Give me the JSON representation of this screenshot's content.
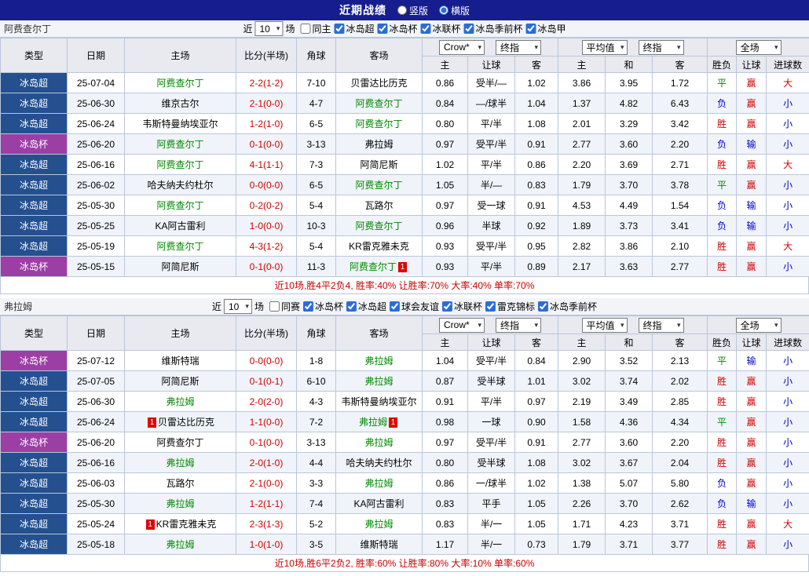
{
  "colors": {
    "topbar": "#161D8E",
    "lgsuper": "#24508F",
    "lgcup": "#9B3FA5",
    "win": "#D10000",
    "loss": "#0000CC",
    "draw": "#008800",
    "focus": "#008800",
    "score": "#D10000",
    "summary": "#C80000",
    "rowalt": "#F0F4FA",
    "border": "#B9C6DA",
    "headbg": "#E9E9F0",
    "sectionbg": "#F2F4F8"
  },
  "header": {
    "title": "近期战绩",
    "radio_vertical": "竖版",
    "radio_horizontal": "横版",
    "vertical_selected": false,
    "horizontal_selected": true
  },
  "labels": {
    "near": "近",
    "games": "场"
  },
  "table_headers": {
    "type": "类型",
    "date": "日期",
    "home": "主场",
    "score": "比分(半场)",
    "corner": "角球",
    "away": "客场",
    "odds_select": "Crow*",
    "final_select": "终指",
    "avg_select": "平均值",
    "avg_final_select": "终指",
    "scope_select": "全场",
    "odds_home": "主",
    "odds_handicap": "让球",
    "odds_away": "客",
    "avg_home": "主",
    "avg_draw": "和",
    "avg_away": "客",
    "result": "胜负",
    "handicap_result": "让球",
    "goals": "进球数"
  },
  "sections": [
    {
      "team": "阿费查尔丁",
      "filter": {
        "games_value": "10",
        "checkboxes": [
          {
            "label": "同主",
            "checked": false
          },
          {
            "label": "冰岛超",
            "checked": true
          },
          {
            "label": "冰岛杯",
            "checked": true
          },
          {
            "label": "冰联杯",
            "checked": true
          },
          {
            "label": "冰岛季前杯",
            "checked": true
          },
          {
            "label": "冰岛甲",
            "checked": true
          }
        ]
      },
      "table": {
        "rows": [
          {
            "league": "冰岛超",
            "lg_class": "super",
            "date": "25-07-04",
            "home": "阿费查尔丁",
            "home_focus": true,
            "home_red": "",
            "score": "2-2(1-2)",
            "corner": "7-10",
            "away": "贝雷达比历克",
            "away_focus": false,
            "away_red": "",
            "odds_home": "0.86",
            "handicap": "受半/—",
            "odds_away": "1.02",
            "avg_home": "3.86",
            "avg_draw": "3.95",
            "avg_away": "1.72",
            "result": "平",
            "hcap_result": "赢",
            "goals": "大"
          },
          {
            "league": "冰岛超",
            "lg_class": "super",
            "date": "25-06-30",
            "home": "维京古尔",
            "home_focus": false,
            "home_red": "",
            "score": "2-1(0-0)",
            "corner": "4-7",
            "away": "阿费查尔丁",
            "away_focus": true,
            "away_red": "",
            "odds_home": "0.84",
            "handicap": "—/球半",
            "odds_away": "1.04",
            "avg_home": "1.37",
            "avg_draw": "4.82",
            "avg_away": "6.43",
            "result": "负",
            "hcap_result": "赢",
            "goals": "小"
          },
          {
            "league": "冰岛超",
            "lg_class": "super",
            "date": "25-06-24",
            "home": "韦斯特曼纳埃亚尔",
            "home_focus": false,
            "home_red": "",
            "score": "1-2(1-0)",
            "corner": "6-5",
            "away": "阿费查尔丁",
            "away_focus": true,
            "away_red": "",
            "odds_home": "0.80",
            "handicap": "平/半",
            "odds_away": "1.08",
            "avg_home": "2.01",
            "avg_draw": "3.29",
            "avg_away": "3.42",
            "result": "胜",
            "hcap_result": "赢",
            "goals": "小"
          },
          {
            "league": "冰岛杯",
            "lg_class": "cup",
            "date": "25-06-20",
            "home": "阿费查尔丁",
            "home_focus": true,
            "home_red": "",
            "score": "0-1(0-0)",
            "corner": "3-13",
            "away": "弗拉姆",
            "away_focus": false,
            "away_red": "",
            "odds_home": "0.97",
            "handicap": "受平/半",
            "odds_away": "0.91",
            "avg_home": "2.77",
            "avg_draw": "3.60",
            "avg_away": "2.20",
            "result": "负",
            "hcap_result": "输",
            "goals": "小"
          },
          {
            "league": "冰岛超",
            "lg_class": "super",
            "date": "25-06-16",
            "home": "阿费查尔丁",
            "home_focus": true,
            "home_red": "",
            "score": "4-1(1-1)",
            "corner": "7-3",
            "away": "阿简尼斯",
            "away_focus": false,
            "away_red": "",
            "odds_home": "1.02",
            "handicap": "平/半",
            "odds_away": "0.86",
            "avg_home": "2.20",
            "avg_draw": "3.69",
            "avg_away": "2.71",
            "result": "胜",
            "hcap_result": "赢",
            "goals": "大"
          },
          {
            "league": "冰岛超",
            "lg_class": "super",
            "date": "25-06-02",
            "home": "哈夫纳夫约杜尔",
            "home_focus": false,
            "home_red": "",
            "score": "0-0(0-0)",
            "corner": "6-5",
            "away": "阿费查尔丁",
            "away_focus": true,
            "away_red": "",
            "odds_home": "1.05",
            "handicap": "半/—",
            "odds_away": "0.83",
            "avg_home": "1.79",
            "avg_draw": "3.70",
            "avg_away": "3.78",
            "result": "平",
            "hcap_result": "赢",
            "goals": "小"
          },
          {
            "league": "冰岛超",
            "lg_class": "super",
            "date": "25-05-30",
            "home": "阿费查尔丁",
            "home_focus": true,
            "home_red": "",
            "score": "0-2(0-2)",
            "corner": "5-4",
            "away": "瓦路尔",
            "away_focus": false,
            "away_red": "",
            "odds_home": "0.97",
            "handicap": "受一球",
            "odds_away": "0.91",
            "avg_home": "4.53",
            "avg_draw": "4.49",
            "avg_away": "1.54",
            "result": "负",
            "hcap_result": "输",
            "goals": "小"
          },
          {
            "league": "冰岛超",
            "lg_class": "super",
            "date": "25-05-25",
            "home": "KA阿古雷利",
            "home_focus": false,
            "home_red": "",
            "score": "1-0(0-0)",
            "corner": "10-3",
            "away": "阿费查尔丁",
            "away_focus": true,
            "away_red": "",
            "odds_home": "0.96",
            "handicap": "半球",
            "odds_away": "0.92",
            "avg_home": "1.89",
            "avg_draw": "3.73",
            "avg_away": "3.41",
            "result": "负",
            "hcap_result": "输",
            "goals": "小"
          },
          {
            "league": "冰岛超",
            "lg_class": "super",
            "date": "25-05-19",
            "home": "阿费查尔丁",
            "home_focus": true,
            "home_red": "",
            "score": "4-3(1-2)",
            "corner": "5-4",
            "away": "KR雷克雅未克",
            "away_focus": false,
            "away_red": "",
            "odds_home": "0.93",
            "handicap": "受平/半",
            "odds_away": "0.95",
            "avg_home": "2.82",
            "avg_draw": "3.86",
            "avg_away": "2.10",
            "result": "胜",
            "hcap_result": "赢",
            "goals": "大"
          },
          {
            "league": "冰岛杯",
            "lg_class": "cup",
            "date": "25-05-15",
            "home": "阿简尼斯",
            "home_focus": false,
            "home_red": "",
            "score": "0-1(0-0)",
            "corner": "11-3",
            "away": "阿费查尔丁",
            "away_focus": true,
            "away_red": "1",
            "odds_home": "0.93",
            "handicap": "平/半",
            "odds_away": "0.89",
            "avg_home": "2.17",
            "avg_draw": "3.63",
            "avg_away": "2.77",
            "result": "胜",
            "hcap_result": "赢",
            "goals": "小"
          }
        ]
      },
      "summary": "近10场,胜4平2负4, 胜率:40% 让胜率:70% 大率:40% 单率:70%"
    },
    {
      "team": "弗拉姆",
      "filter": {
        "games_value": "10",
        "checkboxes": [
          {
            "label": "同赛",
            "checked": false
          },
          {
            "label": "冰岛杯",
            "checked": true
          },
          {
            "label": "冰岛超",
            "checked": true
          },
          {
            "label": "球会友谊",
            "checked": true
          },
          {
            "label": "冰联杯",
            "checked": true
          },
          {
            "label": "雷克锦标",
            "checked": true
          },
          {
            "label": "冰岛季前杯",
            "checked": true
          }
        ]
      },
      "table": {
        "rows": [
          {
            "league": "冰岛杯",
            "lg_class": "cup",
            "date": "25-07-12",
            "home": "维斯特瑞",
            "home_focus": false,
            "home_red": "",
            "score": "0-0(0-0)",
            "corner": "1-8",
            "away": "弗拉姆",
            "away_focus": true,
            "away_red": "",
            "odds_home": "1.04",
            "handicap": "受平/半",
            "odds_away": "0.84",
            "avg_home": "2.90",
            "avg_draw": "3.52",
            "avg_away": "2.13",
            "result": "平",
            "hcap_result": "输",
            "goals": "小"
          },
          {
            "league": "冰岛超",
            "lg_class": "super",
            "date": "25-07-05",
            "home": "阿简尼斯",
            "home_focus": false,
            "home_red": "",
            "score": "0-1(0-1)",
            "corner": "6-10",
            "away": "弗拉姆",
            "away_focus": true,
            "away_red": "",
            "odds_home": "0.87",
            "handicap": "受半球",
            "odds_away": "1.01",
            "avg_home": "3.02",
            "avg_draw": "3.74",
            "avg_away": "2.02",
            "result": "胜",
            "hcap_result": "赢",
            "goals": "小"
          },
          {
            "league": "冰岛超",
            "lg_class": "super",
            "date": "25-06-30",
            "home": "弗拉姆",
            "home_focus": true,
            "home_red": "",
            "score": "2-0(2-0)",
            "corner": "4-3",
            "away": "韦斯特曼纳埃亚尔",
            "away_focus": false,
            "away_red": "",
            "odds_home": "0.91",
            "handicap": "平/半",
            "odds_away": "0.97",
            "avg_home": "2.19",
            "avg_draw": "3.49",
            "avg_away": "2.85",
            "result": "胜",
            "hcap_result": "赢",
            "goals": "小"
          },
          {
            "league": "冰岛超",
            "lg_class": "super",
            "date": "25-06-24",
            "home": "贝雷达比历克",
            "home_focus": false,
            "home_red": "1",
            "score": "1-1(0-0)",
            "corner": "7-2",
            "away": "弗拉姆",
            "away_focus": true,
            "away_red": "1",
            "odds_home": "0.98",
            "handicap": "一球",
            "odds_away": "0.90",
            "avg_home": "1.58",
            "avg_draw": "4.36",
            "avg_away": "4.34",
            "result": "平",
            "hcap_result": "赢",
            "goals": "小"
          },
          {
            "league": "冰岛杯",
            "lg_class": "cup",
            "date": "25-06-20",
            "home": "阿费查尔丁",
            "home_focus": false,
            "home_red": "",
            "score": "0-1(0-0)",
            "corner": "3-13",
            "away": "弗拉姆",
            "away_focus": true,
            "away_red": "",
            "odds_home": "0.97",
            "handicap": "受平/半",
            "odds_away": "0.91",
            "avg_home": "2.77",
            "avg_draw": "3.60",
            "avg_away": "2.20",
            "result": "胜",
            "hcap_result": "赢",
            "goals": "小"
          },
          {
            "league": "冰岛超",
            "lg_class": "super",
            "date": "25-06-16",
            "home": "弗拉姆",
            "home_focus": true,
            "home_red": "",
            "score": "2-0(1-0)",
            "corner": "4-4",
            "away": "哈夫纳夫约杜尔",
            "away_focus": false,
            "away_red": "",
            "odds_home": "0.80",
            "handicap": "受半球",
            "odds_away": "1.08",
            "avg_home": "3.02",
            "avg_draw": "3.67",
            "avg_away": "2.04",
            "result": "胜",
            "hcap_result": "赢",
            "goals": "小"
          },
          {
            "league": "冰岛超",
            "lg_class": "super",
            "date": "25-06-03",
            "home": "瓦路尔",
            "home_focus": false,
            "home_red": "",
            "score": "2-1(0-0)",
            "corner": "3-3",
            "away": "弗拉姆",
            "away_focus": true,
            "away_red": "",
            "odds_home": "0.86",
            "handicap": "一/球半",
            "odds_away": "1.02",
            "avg_home": "1.38",
            "avg_draw": "5.07",
            "avg_away": "5.80",
            "result": "负",
            "hcap_result": "赢",
            "goals": "小"
          },
          {
            "league": "冰岛超",
            "lg_class": "super",
            "date": "25-05-30",
            "home": "弗拉姆",
            "home_focus": true,
            "home_red": "",
            "score": "1-2(1-1)",
            "corner": "7-4",
            "away": "KA阿古雷利",
            "away_focus": false,
            "away_red": "",
            "odds_home": "0.83",
            "handicap": "平手",
            "odds_away": "1.05",
            "avg_home": "2.26",
            "avg_draw": "3.70",
            "avg_away": "2.62",
            "result": "负",
            "hcap_result": "输",
            "goals": "小"
          },
          {
            "league": "冰岛超",
            "lg_class": "super",
            "date": "25-05-24",
            "home": "KR雷克雅未克",
            "home_focus": false,
            "home_red": "1",
            "score": "2-3(1-3)",
            "corner": "5-2",
            "away": "弗拉姆",
            "away_focus": true,
            "away_red": "",
            "odds_home": "0.83",
            "handicap": "半/一",
            "odds_away": "1.05",
            "avg_home": "1.71",
            "avg_draw": "4.23",
            "avg_away": "3.71",
            "result": "胜",
            "hcap_result": "赢",
            "goals": "大"
          },
          {
            "league": "冰岛超",
            "lg_class": "super",
            "date": "25-05-18",
            "home": "弗拉姆",
            "home_focus": true,
            "home_red": "",
            "score": "1-0(1-0)",
            "corner": "3-5",
            "away": "维斯特瑞",
            "away_focus": false,
            "away_red": "",
            "odds_home": "1.17",
            "handicap": "半/一",
            "odds_away": "0.73",
            "avg_home": "1.79",
            "avg_draw": "3.71",
            "avg_away": "3.77",
            "result": "胜",
            "hcap_result": "赢",
            "goals": "小"
          }
        ]
      },
      "summary": "近10场,胜6平2负2, 胜率:60% 让胜率:80% 大率:10% 单率:60%"
    }
  ]
}
